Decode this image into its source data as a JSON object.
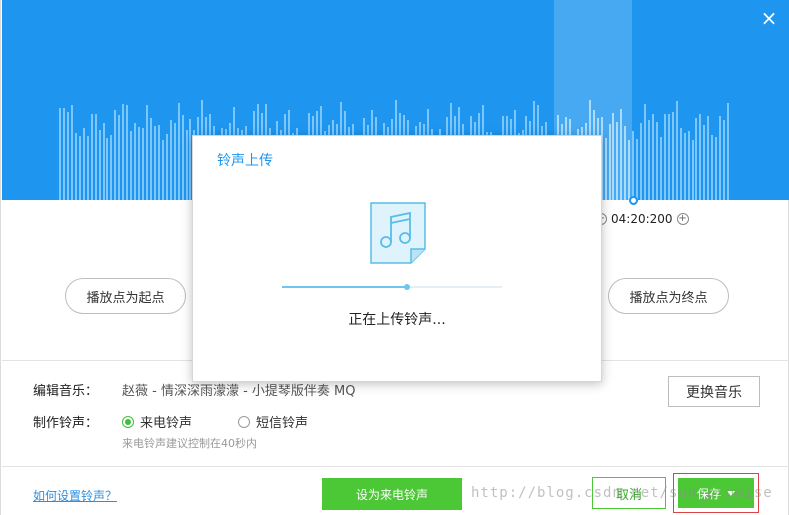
{
  "header": {
    "close_glyph": "×",
    "time_readout": "04:20:200",
    "minus_glyph": "−",
    "plus_glyph": "+"
  },
  "waveform": {
    "bar_count": 170,
    "selection_start_fraction": 0.737,
    "selection_end_fraction": 0.85
  },
  "controls": {
    "set_start_label": "播放点为起点",
    "set_end_label": "播放点为终点"
  },
  "editor": {
    "edit_music_label": "编辑音乐：",
    "music_name": "赵薇 - 情深深雨濛濛 - 小提琴版伴奏  MQ",
    "change_music_label": "更换音乐",
    "make_ringtone_label": "制作铃声：",
    "ringtone_options": [
      {
        "label": "来电铃声",
        "selected": true
      },
      {
        "label": "短信铃声",
        "selected": false
      }
    ],
    "hint": "来电铃声建议控制在40秒内"
  },
  "footer": {
    "help_link": "如何设置铃声？",
    "set_as_ringtone_label": "设为来电铃声",
    "cancel_label": "取消",
    "save_label": "保存",
    "watermark": "http://blog.csdn.net/sun_promise"
  },
  "modal": {
    "title": "铃声上传",
    "status": "正在上传铃声...",
    "progress": 0.57
  },
  "colors": {
    "accent_blue": "#1e96f0",
    "action_green": "#4cc836",
    "highlight_red": "#d94444"
  },
  "icons": {
    "close": "close-icon",
    "file": "music-file-icon",
    "radio": "radio-icon",
    "caret": "caret-down-icon"
  }
}
